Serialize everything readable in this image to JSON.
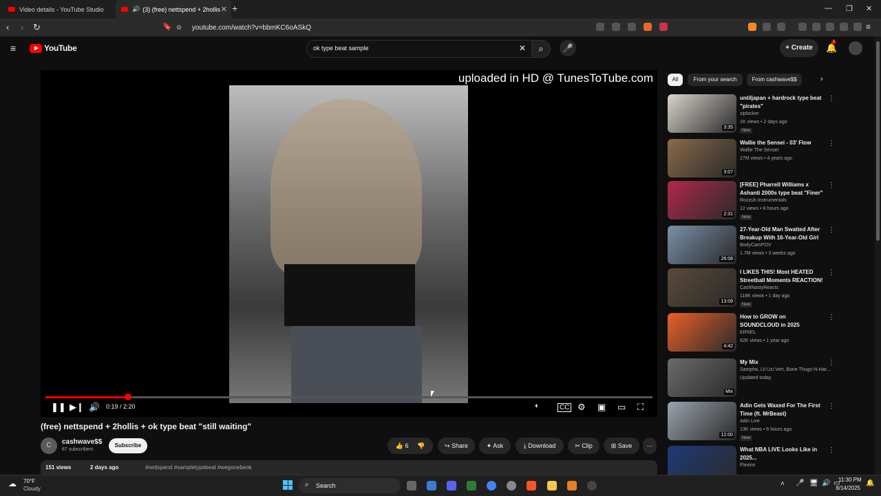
{
  "browser": {
    "tabs": [
      {
        "label": "Video details - YouTube Studio"
      },
      {
        "label": "(3) (free) nettspend + 2hollis"
      }
    ],
    "url": "youtube.com/watch?v=bbmKC6oASkQ"
  },
  "header": {
    "logo": "YouTube",
    "search_value": "ok type beat sample",
    "create_label": "Create",
    "notifications_count": "1"
  },
  "player": {
    "watermark": "uploaded in HD @ TunesToTube.com",
    "time": "0:19 / 2:20",
    "progress_fraction": 0.136
  },
  "video": {
    "title": "(free) nettspend + 2hollis + ok type beat \"still waiting\"",
    "channel": "cashwave$$",
    "channel_initial": "C",
    "subscribers": "87 subscribers",
    "subscribe_label": "Subscribe",
    "likes": "6",
    "share_label": "Share",
    "ask_label": "Ask",
    "download_label": "Download",
    "clip_label": "Clip",
    "save_label": "Save",
    "views": "151 views",
    "age": "2 days ago",
    "tags": "#nettspend #sampletypebeat #wegonebeok"
  },
  "chips": [
    "All",
    "From your search",
    "From cashwave$$"
  ],
  "recommendations": [
    {
      "title": "untiljapan + hardrock type beat \"pirates\"",
      "channel": "ziplocker",
      "meta": "1K views • 2 days ago",
      "badge": "New",
      "duration": "3:35",
      "color": "#d9d4cc"
    },
    {
      "title": "Wallie the Sensei - 03' Flow",
      "channel": "Wallie The Sensei",
      "meta": "27M views • 4 years ago",
      "badge": "",
      "duration": "3:07",
      "color": "#8a6a4a"
    },
    {
      "title": "[FREE] Pharrell Williams x Ashanti 2000s type beat \"Finer\"",
      "channel": "Rozzuh Instrumentals",
      "meta": "12 views • 8 hours ago",
      "badge": "New",
      "duration": "2:31",
      "color": "#b0284a"
    },
    {
      "title": "27-Year-Old Man Swatted After Breakup With 16-Year-Old Girl",
      "channel": "BodyCamPOV",
      "meta": "1.7M views • 3 weeks ago",
      "badge": "",
      "duration": "26:08",
      "color": "#7a8fa8"
    },
    {
      "title": "I LIKES THIS! Most HEATED Streetball Moments REACTION!",
      "channel": "CashNastyReacts",
      "meta": "118K views • 1 day ago",
      "badge": "New",
      "duration": "13:09",
      "color": "#5a4a3a"
    },
    {
      "title": "How to GROW on SOUNDCLOUD in 2025",
      "channel": "KRNEL",
      "meta": "62K views • 1 year ago",
      "badge": "",
      "duration": "4:42",
      "color": "#e8602a"
    },
    {
      "title": "My Mix",
      "channel": "Sampha, Lil Uzi Vert, Bone Thugs-N-Har...",
      "meta": "Updated today",
      "badge": "",
      "duration": "Mix",
      "color": "#6b6b6b"
    },
    {
      "title": "Adin Gets Waxed For The First Time (ft. MrBeast)",
      "channel": "Adin Live",
      "meta": "13K views • 6 hours ago",
      "badge": "New",
      "duration": "12:00",
      "color": "#9aa3ad"
    },
    {
      "title": "What NBA LIVE Looks Like in 2025...",
      "channel": "Flexinn",
      "meta": "",
      "badge": "",
      "duration": "",
      "color": "#1e3a78"
    }
  ],
  "taskbar": {
    "weather_temp": "70°F",
    "weather_desc": "Cloudy",
    "search_label": "Search",
    "time": "11:30 PM",
    "date": "8/14/2025"
  }
}
